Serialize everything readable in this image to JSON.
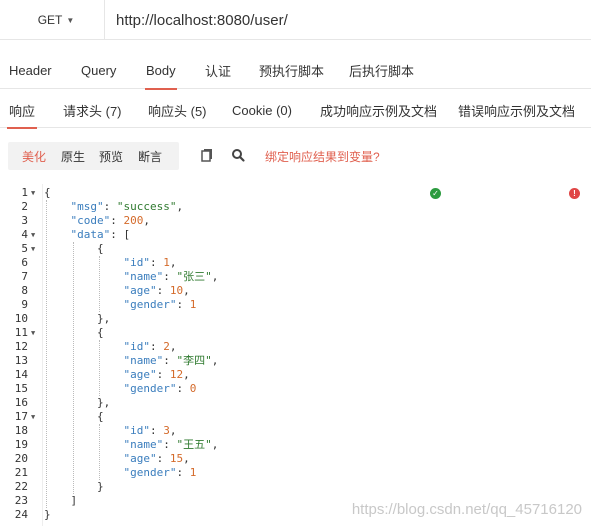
{
  "request": {
    "method": "GET",
    "url": "http://localhost:8080/user/"
  },
  "request_tabs": [
    "Header",
    "Query",
    "Body",
    "认证",
    "预执行脚本",
    "后执行脚本"
  ],
  "request_tab_active": "Body",
  "response_tabs": [
    "响应",
    "请求头 (7)",
    "响应头 (5)",
    "Cookie (0)",
    "成功响应示例及文档",
    "错误响应示例及文档"
  ],
  "response_tab_active": "响应",
  "badges": {
    "success": "✓",
    "error": "!"
  },
  "toolbar": {
    "view_modes": [
      "美化",
      "原生",
      "预览",
      "断言"
    ],
    "active_view": "美化",
    "copy_icon": "copy-icon",
    "search_icon": "search-icon",
    "bind_link": "绑定响应结果到变量?"
  },
  "line_numbers": [
    "1",
    "2",
    "3",
    "4",
    "5",
    "6",
    "7",
    "8",
    "9",
    "10",
    "11",
    "12",
    "13",
    "14",
    "15",
    "16",
    "17",
    "18",
    "19",
    "20",
    "21",
    "22",
    "23",
    "24"
  ],
  "response_body": {
    "msg": "success",
    "code": 200,
    "data": [
      {
        "id": 1,
        "name": "张三",
        "age": 10,
        "gender": 1
      },
      {
        "id": 2,
        "name": "李四",
        "age": 12,
        "gender": 0
      },
      {
        "id": 3,
        "name": "王五",
        "age": 15,
        "gender": 1
      }
    ]
  },
  "watermark": "https://blog.csdn.net/qq_45716120",
  "colors": {
    "accent": "#e0604f",
    "json_key": "#3a7dbd",
    "json_string": "#2f7a2f",
    "json_number": "#d46a2a"
  }
}
